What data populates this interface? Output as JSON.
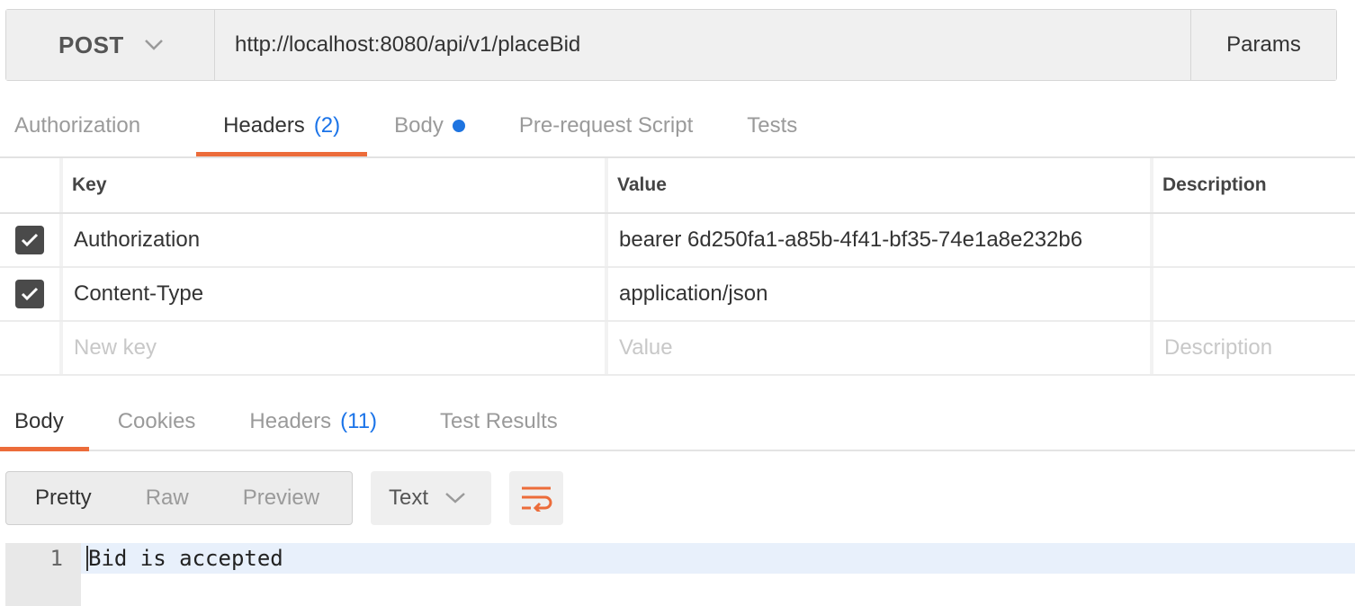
{
  "request": {
    "method": "POST",
    "url": "http://localhost:8080/api/v1/placeBid",
    "params_label": "Params"
  },
  "request_tabs": [
    {
      "label": "Authorization",
      "count": "",
      "active": false
    },
    {
      "label": "Headers",
      "count": "(2)",
      "active": true
    },
    {
      "label": "Body",
      "count": "",
      "active": false,
      "dot": true
    },
    {
      "label": "Pre-request Script",
      "count": "",
      "active": false
    },
    {
      "label": "Tests",
      "count": "",
      "active": false
    }
  ],
  "headers_table": {
    "columns": [
      "Key",
      "Value",
      "Description"
    ],
    "rows": [
      {
        "checked": true,
        "key": "Authorization",
        "value": "bearer 6d250fa1-a85b-4f41-bf35-74e1a8e232b6",
        "description": ""
      },
      {
        "checked": true,
        "key": "Content-Type",
        "value": "application/json",
        "description": ""
      }
    ],
    "new_row": {
      "key_placeholder": "New key",
      "value_placeholder": "Value",
      "description_placeholder": "Description"
    }
  },
  "response_tabs": [
    {
      "label": "Body",
      "count": "",
      "active": true
    },
    {
      "label": "Cookies",
      "count": "",
      "active": false
    },
    {
      "label": "Headers",
      "count": "(11)",
      "active": false
    },
    {
      "label": "Test Results",
      "count": "",
      "active": false
    }
  ],
  "response_toolbar": {
    "views": [
      "Pretty",
      "Raw",
      "Preview"
    ],
    "active_view": "Pretty",
    "format": "Text",
    "wrap_icon": "wrap-lines-icon"
  },
  "response_body": {
    "lines": [
      {
        "number": "1",
        "text": "Bid is accepted"
      }
    ]
  },
  "colors": {
    "accent": "#ec6c3a",
    "count_blue": "#1a73e8",
    "dot_blue": "#1e74e0"
  }
}
